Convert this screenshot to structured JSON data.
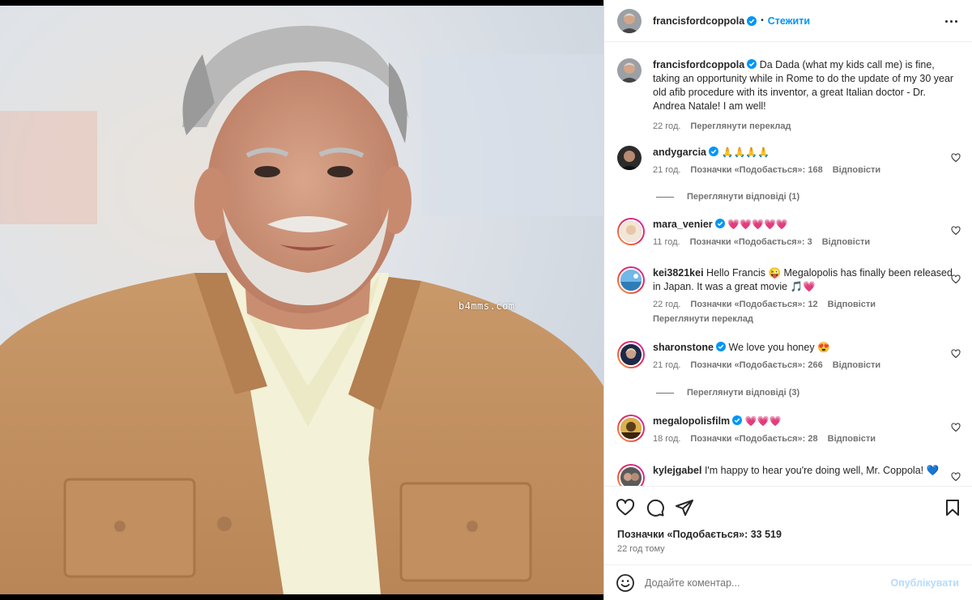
{
  "media": {
    "watermark": "b4mms.com"
  },
  "header": {
    "username": "francisfordcoppola",
    "separator": "•",
    "follow_label": "Стежити"
  },
  "caption": {
    "username": "francisfordcoppola",
    "text": "Da Dada (what my kids call me) is fine, taking an opportunity while in Rome to do the update of my 30 year old afib procedure with its inventor, a great Italian doctor - Dr. Andrea Natale! I am well!",
    "time": "22 год.",
    "translate": "Переглянути переклад"
  },
  "comments": [
    {
      "username": "andygarcia",
      "verified": true,
      "text": "🙏🙏🙏🙏",
      "time": "21 год.",
      "likes": "Позначки «Подобається»: 168",
      "reply": "Відповісти",
      "view_replies": "Переглянути відповіді (1)"
    },
    {
      "username": "mara_venier",
      "verified": true,
      "text": "💗💗💗💗💗",
      "time": "11 год.",
      "likes": "Позначки «Подобається»: 3",
      "reply": "Відповісти"
    },
    {
      "username": "kei3821kei",
      "verified": false,
      "text": "Hello Francis 😜 Megalopolis has finally been released in Japan. It was a great movie 🎵💗",
      "time": "22 год.",
      "likes": "Позначки «Подобається»: 12",
      "reply": "Відповісти",
      "translate": "Переглянути переклад"
    },
    {
      "username": "sharonstone",
      "verified": true,
      "text": "We love you honey 😍",
      "time": "21 год.",
      "likes": "Позначки «Подобається»: 266",
      "reply": "Відповісти",
      "view_replies": "Переглянути відповіді (3)"
    },
    {
      "username": "megalopolisfilm",
      "verified": true,
      "text": "💗💗💗",
      "time": "18 год.",
      "likes": "Позначки «Подобається»: 28",
      "reply": "Відповісти"
    },
    {
      "username": "kylejgabel",
      "verified": false,
      "text": "I'm happy to hear you're doing well, Mr. Coppola! 💙"
    }
  ],
  "actions": {
    "likes_count": "Позначки «Подобається»: 33 519",
    "posted": "22 год тому"
  },
  "add_comment": {
    "placeholder": "Додайте коментар...",
    "publish_label": "Опублікувати"
  },
  "colors": {
    "link": "#0095f6",
    "verified": "#0095f6",
    "muted": "#737373",
    "publish_disabled": "#b3dbff"
  }
}
